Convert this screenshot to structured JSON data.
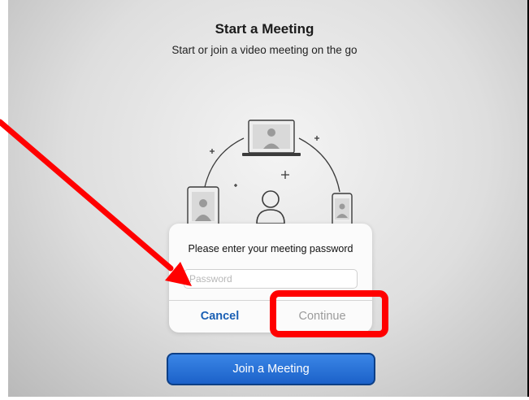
{
  "header": {
    "title": "Start a Meeting",
    "subtitle": "Start or join a video meeting on the go"
  },
  "dialog": {
    "prompt": "Please enter your meeting password",
    "password_placeholder": "Password",
    "cancel_label": "Cancel",
    "continue_label": "Continue"
  },
  "join_button_label": "Join a Meeting",
  "colors": {
    "link_blue": "#1a5fb4",
    "join_button": "#2a73d8",
    "annotation_red": "#ff0000"
  },
  "icons": [
    "laptop-icon",
    "tablet-icon",
    "phone-icon",
    "person-icon",
    "plus-icon"
  ]
}
